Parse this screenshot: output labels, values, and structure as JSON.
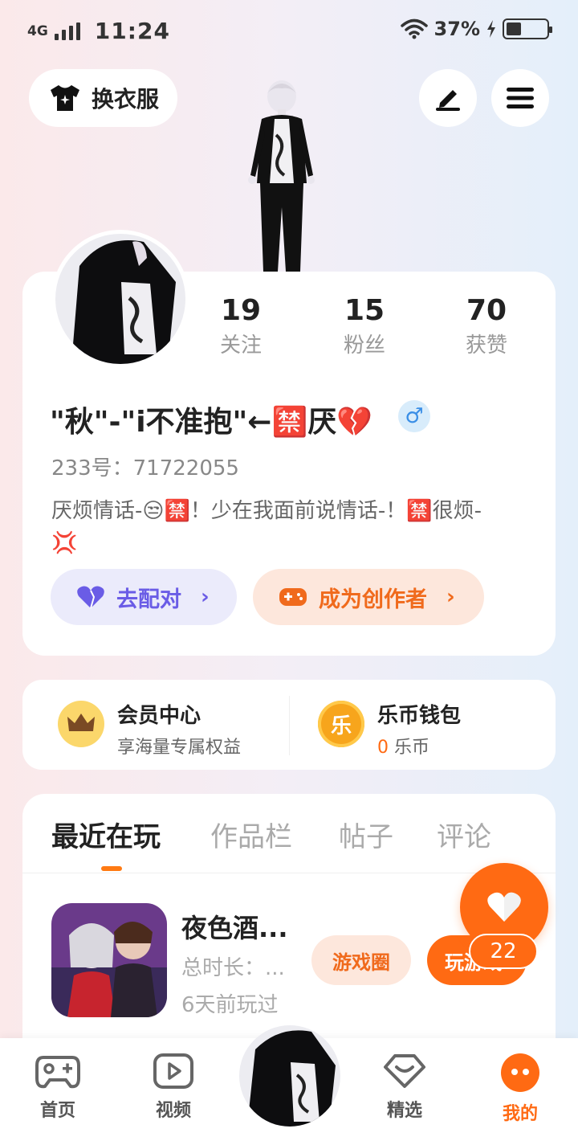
{
  "status_bar": {
    "network": "4G",
    "time": "11:24",
    "battery": "37%",
    "battery_level": 0.37
  },
  "top": {
    "outfit_label": "换衣服",
    "edit_icon": "pen-icon",
    "menu_icon": "menu-icon"
  },
  "profile": {
    "stats": [
      {
        "value": "19",
        "label": "关注"
      },
      {
        "value": "15",
        "label": "粉丝"
      },
      {
        "value": "70",
        "label": "获赞"
      }
    ],
    "username": "\"秋\"-\"i不准抱\"←🈲厌💔",
    "gender_symbol": "♂",
    "account_id": "233号：71722055",
    "bio": "厌烦情话-😒🈲！少在我面前说情话-！🈲很烦-💢",
    "pair_label": "去配对",
    "creator_label": "成为创作者"
  },
  "member": {
    "title": "会员中心",
    "subtitle": "享海量专属权益"
  },
  "wallet": {
    "title": "乐币钱包",
    "badge": "乐",
    "amount": "0",
    "unit": "乐币"
  },
  "tabs": [
    {
      "label": "最近在玩",
      "active": true
    },
    {
      "label": "作品栏",
      "active": false
    },
    {
      "label": "帖子",
      "active": false
    },
    {
      "label": "评论",
      "active": false
    }
  ],
  "recent_game": {
    "title": "夜色酒...",
    "duration": "总时长：...",
    "last_played": "6天前玩过",
    "circle_label": "游戏圈",
    "play_label": "玩游戏"
  },
  "like_fab": {
    "count": "22"
  },
  "bottom_nav": [
    {
      "label": "首页",
      "icon": "gamepad-icon"
    },
    {
      "label": "视频",
      "icon": "video-icon"
    },
    {
      "label": "精选",
      "icon": "heart-diamond-icon"
    },
    {
      "label": "我的",
      "icon": "face-icon",
      "active": true
    }
  ],
  "colors": {
    "accent": "#ff6a13",
    "pair_bg": "#ebebfb",
    "pair_fg": "#6a5ce6",
    "creator_bg": "#fde7dc"
  }
}
